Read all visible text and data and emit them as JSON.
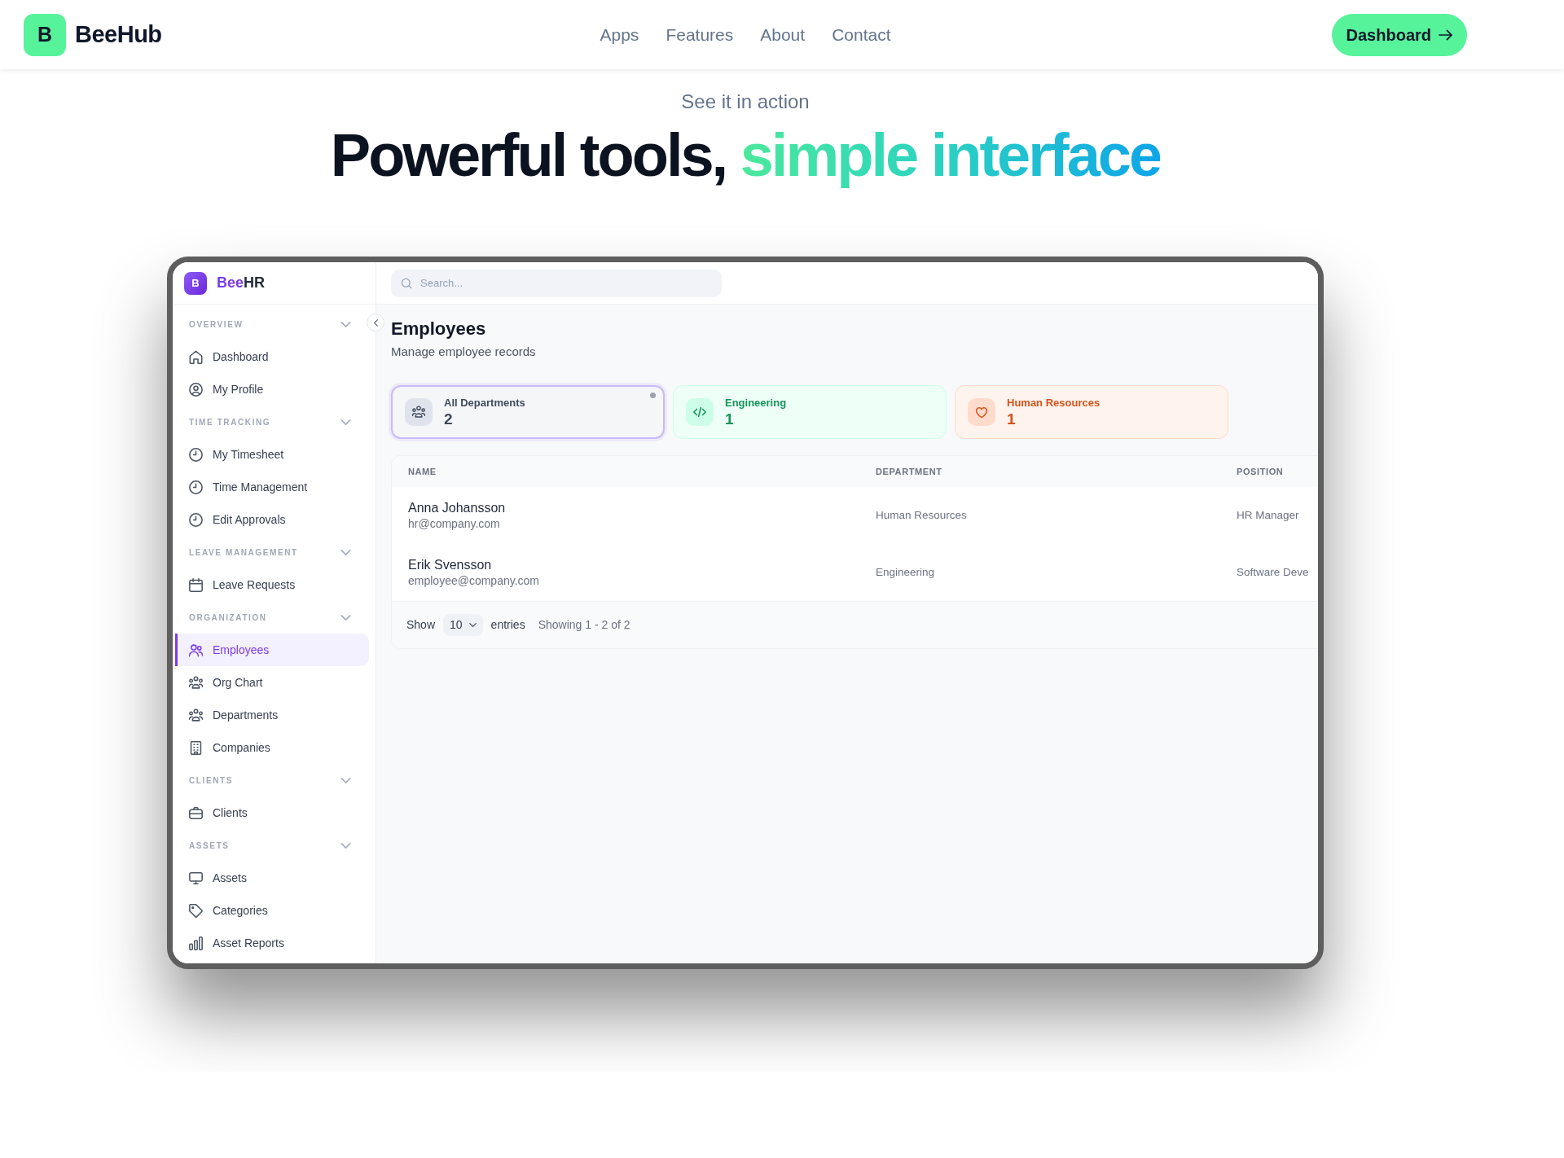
{
  "navbar": {
    "logo": {
      "letter": "B",
      "name": "BeeHub"
    },
    "links": [
      "Apps",
      "Features",
      "About",
      "Contact"
    ],
    "cta": {
      "label": "Dashboard"
    }
  },
  "hero": {
    "eyebrow": "See it in action",
    "title": "Powerful tools,",
    "title_highlight": "simple interface"
  },
  "app": {
    "sidebar": {
      "logo": {
        "letter": "B",
        "brand_accent": "Bee",
        "brand_rest": "HR"
      },
      "sections": [
        {
          "title": "OVERVIEW",
          "expanded": true,
          "items": [
            {
              "label": "Dashboard",
              "selected": false
            },
            {
              "label": "My Profile",
              "selected": false
            }
          ]
        },
        {
          "title": "TIME TRACKING",
          "expanded": true,
          "items": [
            {
              "label": "My Timesheet",
              "selected": false
            },
            {
              "label": "Time Management",
              "selected": false
            },
            {
              "label": "Edit Approvals",
              "selected": false
            }
          ]
        },
        {
          "title": "LEAVE MANAGEMENT",
          "expanded": true,
          "items": [
            {
              "label": "Leave Requests",
              "selected": false
            }
          ]
        },
        {
          "title": "ORGANIZATION",
          "expanded": true,
          "items": [
            {
              "label": "Employees",
              "selected": true
            },
            {
              "label": "Org Chart",
              "selected": false
            },
            {
              "label": "Departments",
              "selected": false
            },
            {
              "label": "Companies",
              "selected": false
            }
          ]
        },
        {
          "title": "CLIENTS",
          "expanded": true,
          "items": [
            {
              "label": "Clients",
              "selected": false
            }
          ]
        },
        {
          "title": "ASSETS",
          "expanded": true,
          "items": [
            {
              "label": "Assets",
              "selected": false
            },
            {
              "label": "Categories",
              "selected": false
            },
            {
              "label": "Asset Reports",
              "selected": false
            }
          ]
        }
      ]
    },
    "search": {
      "placeholder": "Search..."
    },
    "page": {
      "title": "Employees",
      "subtitle": "Manage employee records"
    },
    "stats": [
      {
        "label": "All Departments",
        "value": "2",
        "color": "#3f4a5c",
        "selected": true
      },
      {
        "label": "Engineering",
        "value": "1",
        "color": "#17945a",
        "selected": false
      },
      {
        "label": "Human Resources",
        "value": "1",
        "color": "#d5521a",
        "selected": false
      }
    ],
    "table": {
      "columns": [
        "NAME",
        "DEPARTMENT",
        "POSITION"
      ],
      "rows": [
        {
          "name": "Anna Johansson",
          "email": "hr@company.com",
          "department": "Human Resources",
          "position": "HR Manager"
        },
        {
          "name": "Erik Svensson",
          "email": "employee@company.com",
          "department": "Engineering",
          "position": "Software Deve"
        }
      ],
      "footer": {
        "show_label": "Show",
        "page_size": "10",
        "entries_label": "entries",
        "summary": "Showing 1 - 2 of 2"
      }
    }
  }
}
